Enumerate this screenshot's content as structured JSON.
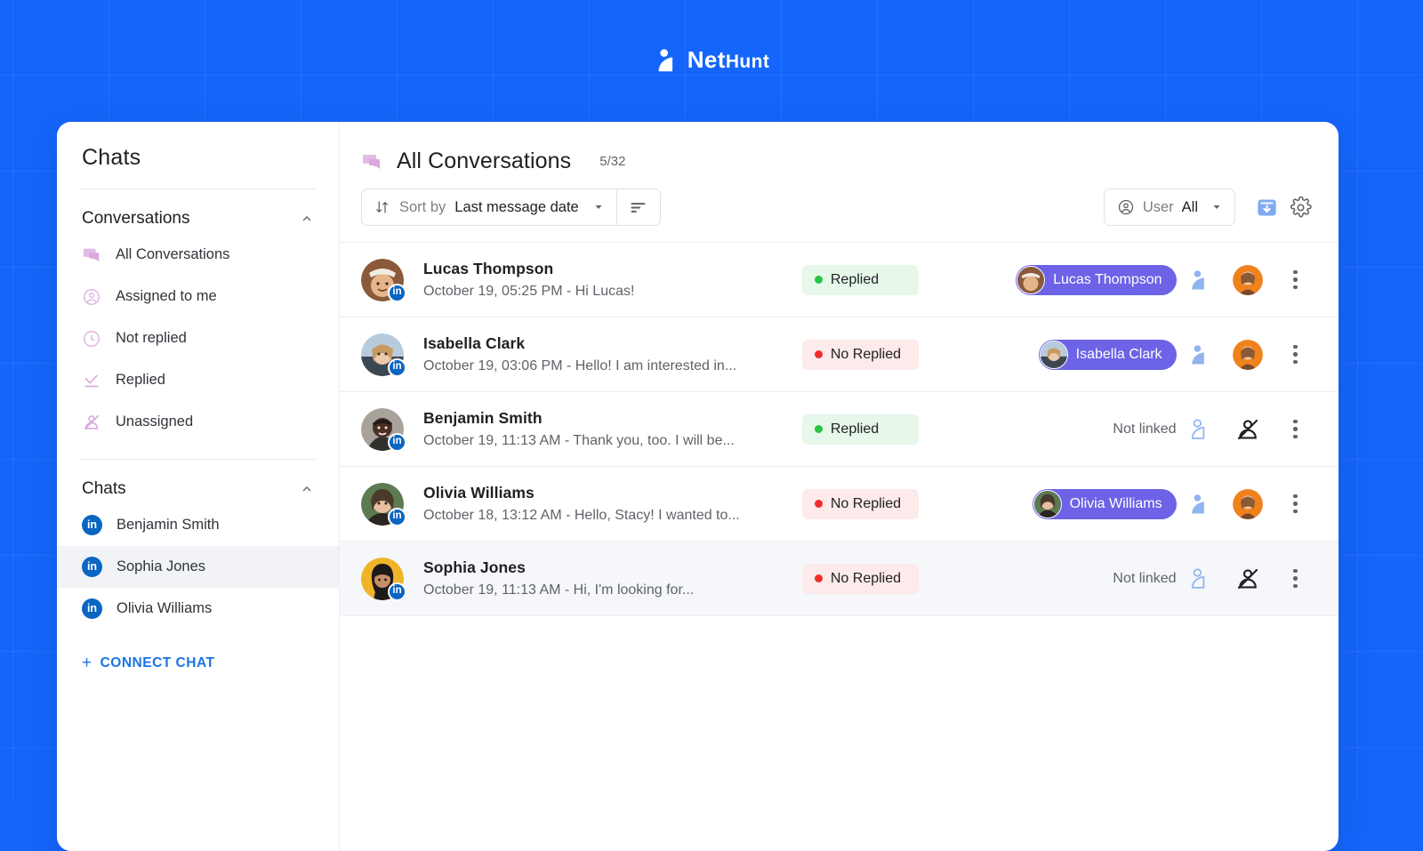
{
  "brand": {
    "name_part1": "Net",
    "name_part2": "Hunt",
    "logo_icon": "nethunt-logo-mark",
    "background_color": "#1565fb"
  },
  "sidebar": {
    "title": "Chats",
    "sections": [
      {
        "label": "Conversations",
        "collapse_icon": "chevron-up-icon",
        "items": [
          {
            "label": "All Conversations",
            "icon": "conversations-icon",
            "selected": false
          },
          {
            "label": "Assigned to me",
            "icon": "user-circle-icon",
            "selected": false
          },
          {
            "label": "Not replied",
            "icon": "clock-icon",
            "selected": false
          },
          {
            "label": "Replied",
            "icon": "check-replied-icon",
            "selected": false
          },
          {
            "label": "Unassigned",
            "icon": "user-crossed-icon",
            "selected": false
          }
        ]
      },
      {
        "label": "Chats",
        "collapse_icon": "chevron-up-icon",
        "items": [
          {
            "label": "Benjamin Smith",
            "icon": "linkedin-icon",
            "selected": false
          },
          {
            "label": "Sophia Jones",
            "icon": "linkedin-icon",
            "selected": true
          },
          {
            "label": "Olivia Williams",
            "icon": "linkedin-icon",
            "selected": false
          }
        ]
      }
    ],
    "connect_chat": {
      "label": "CONNECT CHAT",
      "icon": "plus-icon",
      "color": "#1a73e8"
    }
  },
  "main": {
    "header": {
      "icon": "conversations-icon",
      "title": "All Conversations",
      "count": "5/32"
    },
    "toolbar": {
      "sort": {
        "icon": "sort-arrows-icon",
        "prefix": "Sort by",
        "value": "Last message date",
        "caret_icon": "chevron-down-icon"
      },
      "sort_lines_button": {
        "icon": "sort-lines-icon"
      },
      "user_filter": {
        "icon": "user-circle-icon",
        "prefix": "User",
        "value": "All",
        "caret_icon": "chevron-down-icon"
      },
      "archive_button": {
        "icon": "archive-download-icon",
        "color": "#7faaf0"
      },
      "settings_button": {
        "icon": "gear-icon"
      }
    },
    "conversations": [
      {
        "name": "Lucas Thompson",
        "snippet": "October 19, 05:25 PM - Hi Lucas!",
        "channel_icon": "linkedin-icon",
        "status": {
          "label": "Replied",
          "type": "replied"
        },
        "linked": {
          "linked": true,
          "label": "Lucas Thompson"
        },
        "link_action_icon": "nethunt-link-filled-icon",
        "assignee": {
          "assigned": true
        },
        "menu_icon": "kebab-menu-icon",
        "selected": false,
        "avatar_colors": [
          "#d6a45c",
          "#8a5a3b"
        ]
      },
      {
        "name": "Isabella Clark",
        "snippet": "October 19, 03:06 PM - Hello! I am interested in...",
        "channel_icon": "linkedin-icon",
        "status": {
          "label": "No Replied",
          "type": "noreplied"
        },
        "linked": {
          "linked": true,
          "label": "Isabella Clark"
        },
        "link_action_icon": "nethunt-link-filled-icon",
        "assignee": {
          "assigned": true
        },
        "menu_icon": "kebab-menu-icon",
        "selected": false,
        "avatar_colors": [
          "#b8cbdd",
          "#6d7b88"
        ]
      },
      {
        "name": "Benjamin Smith",
        "snippet": "October 19, 11:13 AM - Thank you, too. I will be...",
        "channel_icon": "linkedin-icon",
        "status": {
          "label": "Replied",
          "type": "replied"
        },
        "linked": {
          "linked": false,
          "label": "Not linked"
        },
        "link_action_icon": "nethunt-link-outline-icon",
        "assignee": {
          "assigned": false,
          "icon": "user-crossed-icon"
        },
        "menu_icon": "kebab-menu-icon",
        "selected": false,
        "avatar_colors": [
          "#a9a29b",
          "#3c3330"
        ]
      },
      {
        "name": "Olivia Williams",
        "snippet": "October 18, 13:12 AM - Hello, Stacy! I wanted to...",
        "channel_icon": "linkedin-icon",
        "status": {
          "label": "No Replied",
          "type": "noreplied"
        },
        "linked": {
          "linked": true,
          "label": "Olivia Williams"
        },
        "link_action_icon": "nethunt-link-filled-icon",
        "assignee": {
          "assigned": true
        },
        "menu_icon": "kebab-menu-icon",
        "selected": false,
        "avatar_colors": [
          "#5d7a52",
          "#2e3a2a"
        ]
      },
      {
        "name": "Sophia Jones",
        "snippet": "October 19, 11:13 AM - Hi, I'm looking for...",
        "channel_icon": "linkedin-icon",
        "status": {
          "label": "No Replied",
          "type": "noreplied"
        },
        "linked": {
          "linked": false,
          "label": "Not linked"
        },
        "link_action_icon": "nethunt-link-outline-icon",
        "assignee": {
          "assigned": false,
          "icon": "user-crossed-icon"
        },
        "menu_icon": "kebab-menu-icon",
        "selected": true,
        "avatar_colors": [
          "#f0b429",
          "#1d1b1a"
        ]
      }
    ],
    "colors": {
      "chip_purple": "#6c63e6",
      "replied_bg": "#e7f7ea",
      "replied_dot": "#25c445",
      "noreplied_bg": "#fdeaea",
      "noreplied_dot": "#f02d2d",
      "linkedin_blue": "#0a66c2",
      "link_icon_blue": "#8fb4ee",
      "assignee_ring": "#f0821e"
    }
  }
}
